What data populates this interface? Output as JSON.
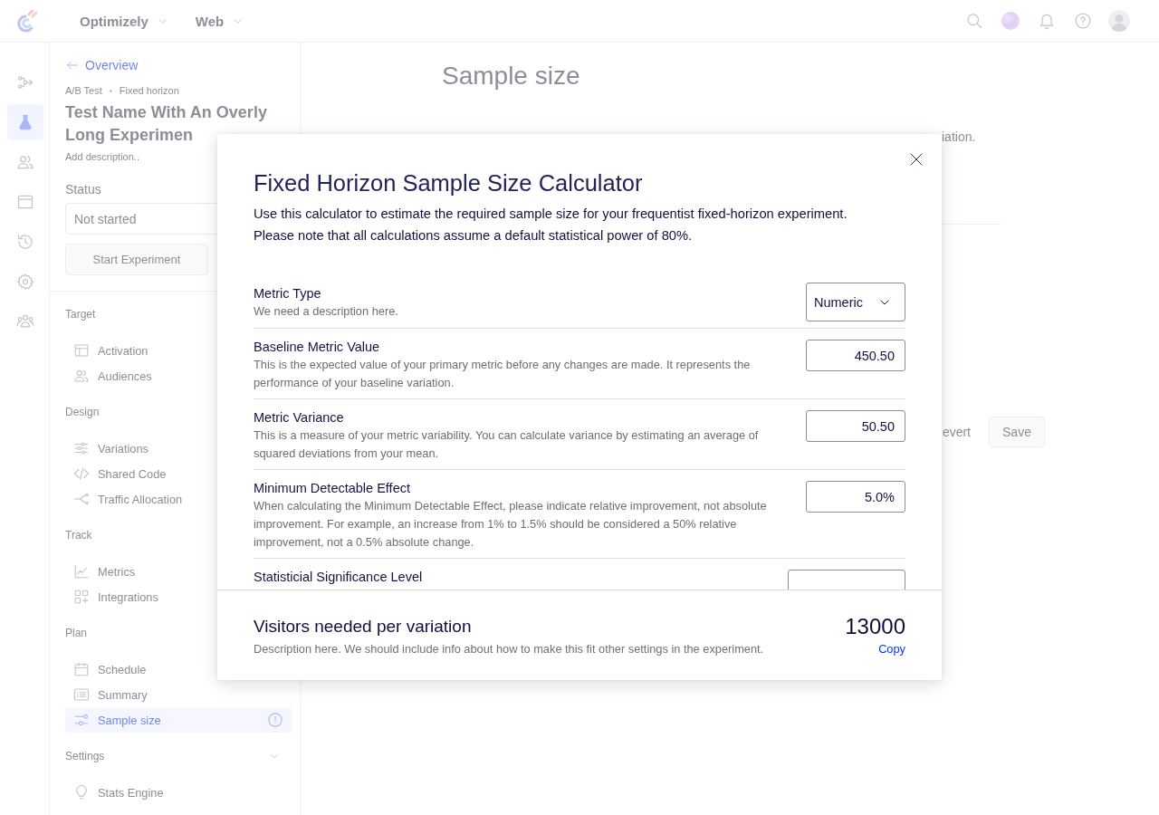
{
  "top_bar": {
    "menus": [
      {
        "label": "Optimizely"
      },
      {
        "label": "Web"
      }
    ]
  },
  "rail": [
    {
      "selected": false
    },
    {
      "selected": true
    },
    {
      "selected": false
    },
    {
      "selected": false
    },
    {
      "selected": false
    },
    {
      "selected": false
    },
    {
      "selected": false
    }
  ],
  "experiment": {
    "back_link": "Overview",
    "breadcrumb": [
      "A/B Test",
      "Fixed horizon"
    ],
    "title": "Test Name With An Overly Long Experimen",
    "description": {
      "placeholder": "Add description.."
    },
    "status": {
      "label": "Status",
      "value": "Not started"
    },
    "start_button": "Start Experiment"
  },
  "nav": [
    {
      "heading": "Target",
      "kind": "plain",
      "items": [
        {
          "label": "Activation",
          "selected": false,
          "warning": false
        },
        {
          "label": "Audiences",
          "selected": false,
          "warning": false
        }
      ]
    },
    {
      "heading": "Design",
      "kind": "plain",
      "items": [
        {
          "label": "Variations",
          "selected": false,
          "warning": false
        },
        {
          "label": "Shared Code",
          "selected": false,
          "warning": false
        },
        {
          "label": "Traffic Allocation",
          "selected": false,
          "warning": false
        }
      ]
    },
    {
      "heading": "Track",
      "kind": "plain",
      "items": [
        {
          "label": "Metrics",
          "selected": false,
          "warning": false
        },
        {
          "label": "Integrations",
          "selected": false,
          "warning": false
        }
      ]
    },
    {
      "heading": "Plan",
      "kind": "plain",
      "items": [
        {
          "label": "Schedule",
          "selected": false,
          "warning": false
        },
        {
          "label": "Summary",
          "selected": false,
          "warning": false
        },
        {
          "label": "Sample size",
          "selected": true,
          "warning": true
        }
      ]
    },
    {
      "heading": "Settings",
      "kind": "collapsible",
      "items": [
        {
          "label": "Stats Engine",
          "selected": false,
          "warning": false
        }
      ]
    }
  ],
  "main": {
    "heading": "Sample size",
    "description": "iation.",
    "actions": [
      {
        "label": "evert",
        "kind": "text"
      },
      {
        "label": "Save",
        "kind": "primary"
      }
    ]
  },
  "modal": {
    "title": "Fixed Horizon Sample Size Calculator",
    "intro": [
      "Use this calculator to estimate the required sample size for your frequentist fixed-horizon experiment.",
      "Please note that all calculations assume a default statistical power of 80%."
    ],
    "fields": [
      {
        "kind": "select",
        "label": "Metric Type",
        "description": "We need a description here.",
        "value": "Numeric"
      },
      {
        "kind": "number",
        "label": "Baseline Metric Value",
        "description": "This is the expected value of your primary metric before any changes are made. It represents the performance of your baseline variation.",
        "value": "450.50"
      },
      {
        "kind": "number",
        "label": "Metric Variance",
        "description": "This is a measure of your metric variability. You can calculate variance by estimating an average of squared deviations from your mean.",
        "value": "50.50"
      },
      {
        "kind": "number",
        "label": "Minimum Detectable Effect",
        "description": "When calculating the Minimum Detectable Effect, please indicate relative improvement, not absolute improvement. For example, an increase from 1% to 1.5% should be considered a 50% relative improvement, not a 0.5% absolute change.",
        "value": "5.0%"
      },
      {
        "kind": "wide",
        "label": "Statisticial Significance Level"
      }
    ],
    "result": {
      "label": "Visitors needed per variation",
      "description": "Description here. We should include info about how to make this fit other settings in the experiment.",
      "value": "13000",
      "copy_link": "Copy"
    }
  }
}
